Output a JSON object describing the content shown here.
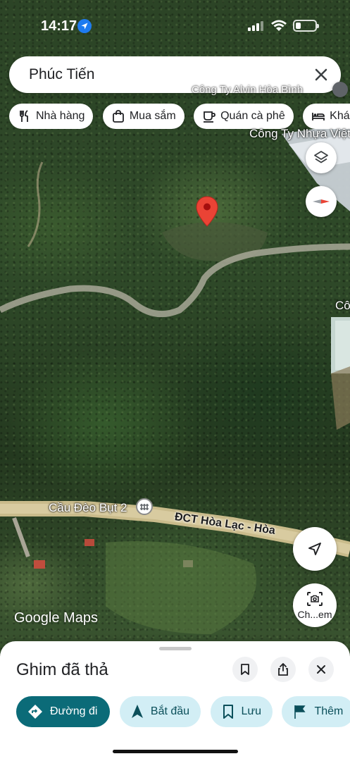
{
  "status_bar": {
    "time": "14:17"
  },
  "search": {
    "query": "Phúc Tiến"
  },
  "chips": [
    {
      "label": "Nhà hàng",
      "icon": "restaurant-icon"
    },
    {
      "label": "Mua sắm",
      "icon": "shopping-bag-icon"
    },
    {
      "label": "Quán cà phê",
      "icon": "coffee-icon"
    },
    {
      "label": "Khách",
      "icon": "hotel-icon"
    }
  ],
  "map_labels": {
    "company_top": "Công Ty Nhựa Việt",
    "company_top_partial": "Công Ty Alvin Hòa Bình",
    "company_right": "Cô",
    "bridge": "Cầu Đèo Bụt 2",
    "road": "ĐCT Hòa Lạc - Hòa"
  },
  "map_controls": {
    "street_view_label": "Ch...em"
  },
  "branding": {
    "logo": "Google Maps"
  },
  "sheet": {
    "title": "Ghim đã thả",
    "actions": [
      {
        "label": "Đường đi",
        "icon": "directions-icon"
      },
      {
        "label": "Bắt đầu",
        "icon": "navigation-icon"
      },
      {
        "label": "Lưu",
        "icon": "bookmark-icon"
      },
      {
        "label": "Thêm",
        "icon": "flag-icon"
      }
    ]
  },
  "colors": {
    "accent": "#0b6b78",
    "accent_light": "#d2eef5",
    "pin": "#ea4335",
    "location_blue": "#1e7bf0"
  }
}
